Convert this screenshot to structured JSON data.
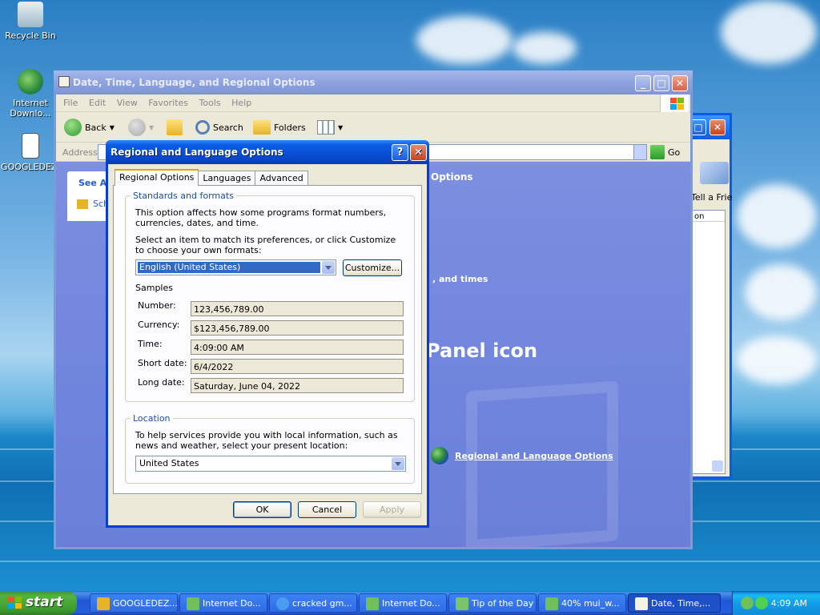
{
  "desktop": {
    "icons": [
      {
        "label": "Recycle Bin",
        "icon": "recycle-bin-icon"
      },
      {
        "label": "Internet Downlo...",
        "icon": "internet-download-icon"
      },
      {
        "label": "GOOGLEDEZ.",
        "icon": "text-document-icon"
      }
    ]
  },
  "explorer": {
    "title": "Date, Time, Language, and Regional Options",
    "menu": [
      "File",
      "Edit",
      "View",
      "Favorites",
      "Tools",
      "Help"
    ],
    "toolbar": {
      "back": "Back",
      "search": "Search",
      "folders": "Folders"
    },
    "address": {
      "label": "Address",
      "go": "Go"
    },
    "see_also": "See Als",
    "see_also_item": "Sch",
    "content": {
      "task_heading": "Options",
      "task_item": ", and times",
      "panel_heading": "Panel icon",
      "regional_link": "Regional and Language Options"
    }
  },
  "back_window": {
    "label": "Tell a Frie",
    "column": "on"
  },
  "dialog": {
    "title": "Regional and Language Options",
    "help_glyph": "?",
    "close_glyph": "✕",
    "tabs": [
      {
        "label": "Regional Options",
        "active": true
      },
      {
        "label": "Languages",
        "active": false
      },
      {
        "label": "Advanced",
        "active": false
      }
    ],
    "standards": {
      "legend": "Standards and formats",
      "description": "This option affects how some programs format numbers, currencies, dates, and time.",
      "instruction": "Select an item to match its preferences, or click Customize to choose your own formats:",
      "selected_format": "English (United States)",
      "customize_label": "Customize...",
      "samples_heading": "Samples",
      "samples": [
        {
          "label": "Number:",
          "value": "123,456,789.00"
        },
        {
          "label": "Currency:",
          "value": "$123,456,789.00"
        },
        {
          "label": "Time:",
          "value": "4:09:00 AM"
        },
        {
          "label": "Short date:",
          "value": "6/4/2022"
        },
        {
          "label": "Long date:",
          "value": "Saturday, June 04, 2022"
        }
      ]
    },
    "location": {
      "legend": "Location",
      "description": "To help services provide you with local information, such as news and weather, select your present location:",
      "selected": "United States"
    },
    "buttons": {
      "ok": "OK",
      "cancel": "Cancel",
      "apply": "Apply"
    }
  },
  "taskbar": {
    "start_label": "start",
    "tasks": [
      {
        "label": "GOOGLEDEZ...",
        "icon": "folder-icon"
      },
      {
        "label": "Internet Do...",
        "icon": "download-icon"
      },
      {
        "label": "cracked gm...",
        "icon": "ie-icon"
      },
      {
        "label": "Internet Do...",
        "icon": "download-icon"
      },
      {
        "label": "Tip of the Day",
        "icon": "tip-icon"
      },
      {
        "label": "40% mui_w...",
        "icon": "download-icon"
      },
      {
        "label": "Date, Time,...",
        "icon": "control-panel-icon",
        "active": true
      }
    ],
    "clock": "4:09 AM"
  }
}
